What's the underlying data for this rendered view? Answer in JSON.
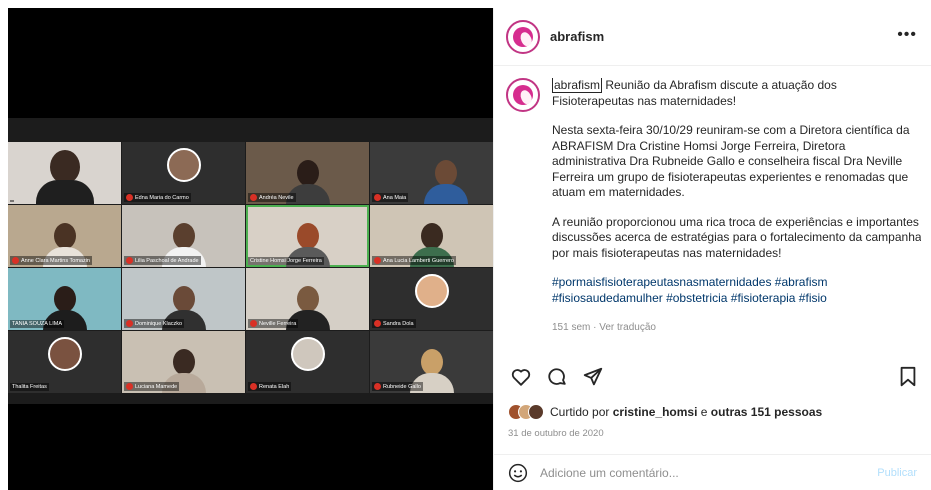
{
  "post": {
    "username": "abrafism",
    "more_label": "•••",
    "caption": {
      "handle": "abrafism",
      "title": "Reunião da Abrafism discute a atuação dos Fisioterapeutas nas maternidades!",
      "paragraph1": "Nesta sexta-feira 30/10/29 reuniram-se com a Diretora científica da ABRAFISM Dra Cristine Homsi Jorge Ferreira, Diretora administrativa Dra Rubneide Gallo e conselheira fiscal Dra Neville Ferreira um grupo de fisioterapeutas experientes e renomadas que atuam em maternidades.",
      "paragraph2": "A reunião proporcionou uma rica troca de experiências e importantes discussões acerca de estratégias para o fortalecimento da campanha por mais fisioterapeutas nas maternidades!",
      "hashtags": "#pormaisfisioterapeutasnasmaternidades #abrafism #fisiosaudedamulher #obstetricia #fisioterapia #fisio",
      "meta": "151 sem · Ver tradução"
    },
    "likes": {
      "prefix": "Curtido por",
      "user": "cristine_homsi",
      "middle": "e",
      "others": "outras 151 pessoas"
    },
    "date": "31 de outubro de 2020",
    "comment": {
      "placeholder": "Adicione um comentário...",
      "post_label": "Publicar"
    }
  },
  "meeting": {
    "participants": [
      {
        "name": ""
      },
      {
        "name": "Edna Maria do Carmo"
      },
      {
        "name": "Andréa Nevile"
      },
      {
        "name": "Ana Maia"
      },
      {
        "name": "Anne Clara Martins Tomazin"
      },
      {
        "name": "Lilia Paschoal de Andrade"
      },
      {
        "name": "Cristine Homsi Jorge Ferreira"
      },
      {
        "name": "Ana Lucia Lamberti Guerrero"
      },
      {
        "name": "TANIA SOUZA LIMA"
      },
      {
        "name": "Dominique Klaczko"
      },
      {
        "name": "Neville Ferreira"
      },
      {
        "name": "Sandra Dola"
      },
      {
        "name": "Thalita Freitas"
      },
      {
        "name": "Luciana Mamede"
      },
      {
        "name": "Renata Elah"
      },
      {
        "name": "Rubneide Gallo"
      }
    ]
  },
  "colors": {
    "accent_link": "#00376b",
    "brand_ring": "#c13584",
    "muted": "#8e8e8e"
  },
  "icons": [
    "heart-icon",
    "comment-icon",
    "share-icon",
    "bookmark-icon",
    "emoji-icon",
    "more-icon"
  ]
}
